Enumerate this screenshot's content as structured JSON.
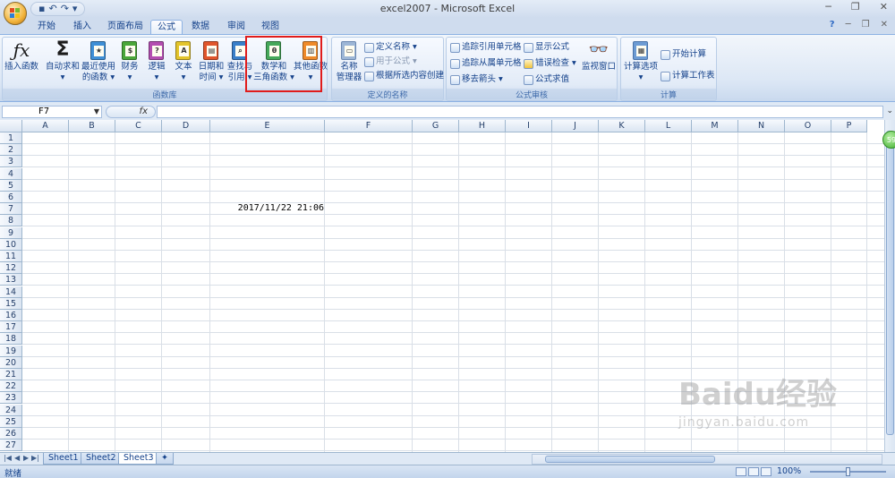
{
  "window": {
    "title": "excel2007 - Microsoft Excel",
    "qat_icons": [
      "save-icon",
      "undo-icon",
      "redo-icon",
      "customize-qat-icon"
    ]
  },
  "tabs": [
    {
      "label": "开始",
      "active": false
    },
    {
      "label": "插入",
      "active": false
    },
    {
      "label": "页面布局",
      "active": false
    },
    {
      "label": "公式",
      "active": true
    },
    {
      "label": "数据",
      "active": false
    },
    {
      "label": "审阅",
      "active": false
    },
    {
      "label": "视图",
      "active": false
    }
  ],
  "ribbon": {
    "groups": {
      "function_library": "函数库",
      "defined_names": "定义的名称",
      "formula_auditing": "公式审核",
      "calculation": "计算"
    },
    "function_library_buttons": [
      {
        "label1": "插入函数",
        "label2": "",
        "icon": "fx-icon"
      },
      {
        "label1": "自动求和",
        "label2": "▾",
        "icon": "sigma-icon"
      },
      {
        "label1": "最近使用",
        "label2": "的函数 ▾",
        "icon": "recent-book-icon"
      },
      {
        "label1": "财务",
        "label2": "▾",
        "icon": "financial-book-icon"
      },
      {
        "label1": "逻辑",
        "label2": "▾",
        "icon": "logical-book-icon"
      },
      {
        "label1": "文本",
        "label2": "▾",
        "icon": "text-book-icon"
      },
      {
        "label1": "日期和",
        "label2": "时间 ▾",
        "icon": "datetime-book-icon"
      },
      {
        "label1": "查找与",
        "label2": "引用 ▾",
        "icon": "lookup-book-icon"
      },
      {
        "label1": "数学和",
        "label2": "三角函数 ▾",
        "icon": "math-trig-book-icon"
      },
      {
        "label1": "其他函数",
        "label2": "▾",
        "icon": "more-functions-book-icon"
      }
    ],
    "name_manager": {
      "label1": "名称",
      "label2": "管理器"
    },
    "defined_names_items": [
      "定义名称 ▾",
      "用于公式 ▾",
      "根据所选内容创建"
    ],
    "auditing_items": [
      "追踪引用单元格",
      "追踪从属单元格",
      "移去箭头 ▾",
      "显示公式",
      "错误检查 ▾",
      "公式求值"
    ],
    "watch_window": "监视窗口",
    "calc_options": {
      "label1": "计算选项",
      "label2": "▾"
    },
    "calc_items": [
      "开始计算",
      "计算工作表"
    ],
    "help": "?"
  },
  "formula_bar": {
    "name_box": "F7",
    "fx": "fx",
    "value": ""
  },
  "grid": {
    "columns": [
      "A",
      "B",
      "C",
      "D",
      "E",
      "F",
      "G",
      "H",
      "I",
      "J",
      "K",
      "L",
      "M",
      "N",
      "O",
      "P"
    ],
    "rows": [
      "1",
      "2",
      "3",
      "4",
      "5",
      "6",
      "7",
      "8",
      "9",
      "10",
      "11",
      "12",
      "13",
      "14",
      "15",
      "16",
      "17",
      "18",
      "19",
      "20",
      "21",
      "22",
      "23",
      "24",
      "25",
      "26",
      "27"
    ],
    "cell_e7": "2017/11/22 21:06"
  },
  "sheets": [
    "Sheet1",
    "Sheet2",
    "Sheet3"
  ],
  "active_sheet": "Sheet3",
  "status": {
    "ready": "就绪",
    "zoom": "100%"
  },
  "badge": "59",
  "watermark": {
    "line1": "Baidu经验",
    "line2": "jingyan.baidu.com"
  }
}
